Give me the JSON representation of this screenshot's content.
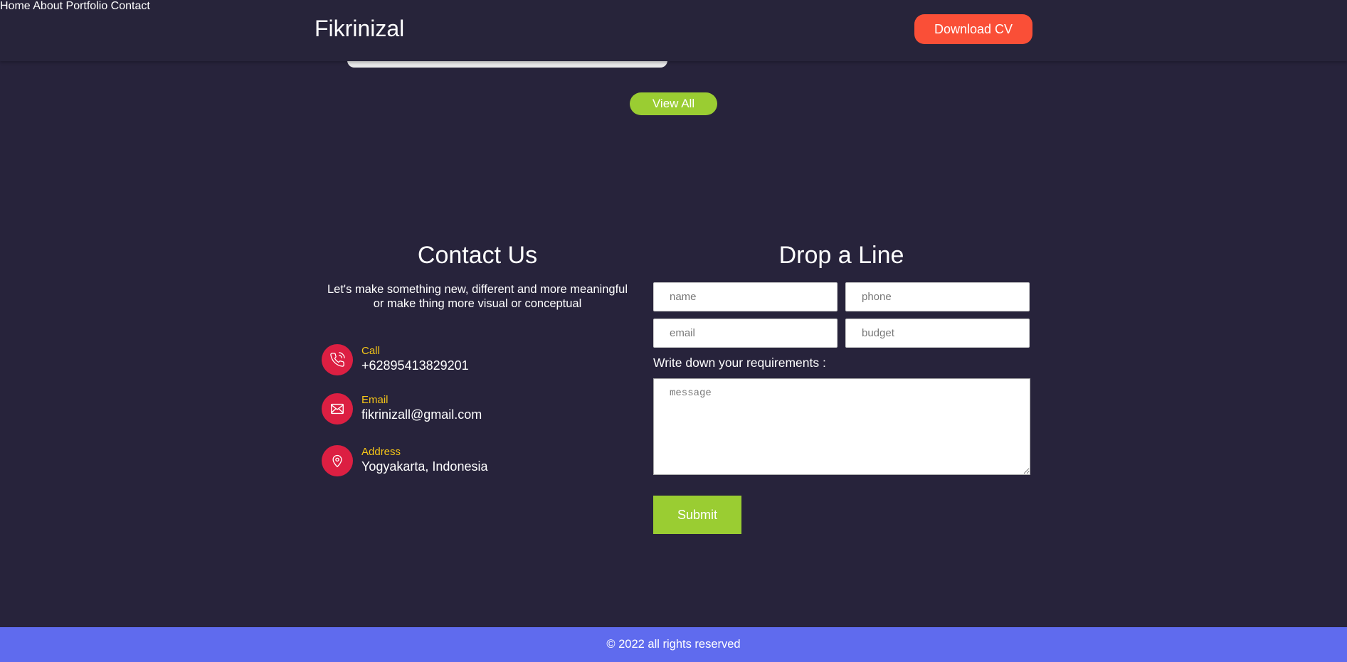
{
  "header": {
    "brand": "Fikrinizal",
    "nav": [
      "Home",
      "About",
      "Portfolio",
      "Contact"
    ],
    "cta_label": "Download CV"
  },
  "portfolio": {
    "view_all_label": "View All"
  },
  "contact": {
    "title": "Contact Us",
    "description_line1": "Let's make something new, different and more meaningful",
    "description_line2": "or make thing more visual or conceptual",
    "items": [
      {
        "label": "Call",
        "value": "+62895413829201",
        "icon": "phone-icon"
      },
      {
        "label": "Email",
        "value": "fikrinizall@gmail.com",
        "icon": "mail-icon"
      },
      {
        "label": "Address",
        "value": "Yogyakarta, Indonesia",
        "icon": "map-pin-icon"
      }
    ]
  },
  "form": {
    "title": "Drop a Line",
    "name_placeholder": "name",
    "phone_placeholder": "phone",
    "email_placeholder": "email",
    "budget_placeholder": "budget",
    "requirements_label": "Write down your requirements :",
    "message_placeholder": "message",
    "submit_label": "Submit"
  },
  "footer": {
    "text": "© 2022 all rights reserved"
  },
  "colors": {
    "background": "#27233b",
    "cta": "#fa4f37",
    "accent_green": "#9acd32",
    "icon_red": "#dc1f42",
    "label_yellow": "#f5c518",
    "footer": "#5f6bee"
  }
}
